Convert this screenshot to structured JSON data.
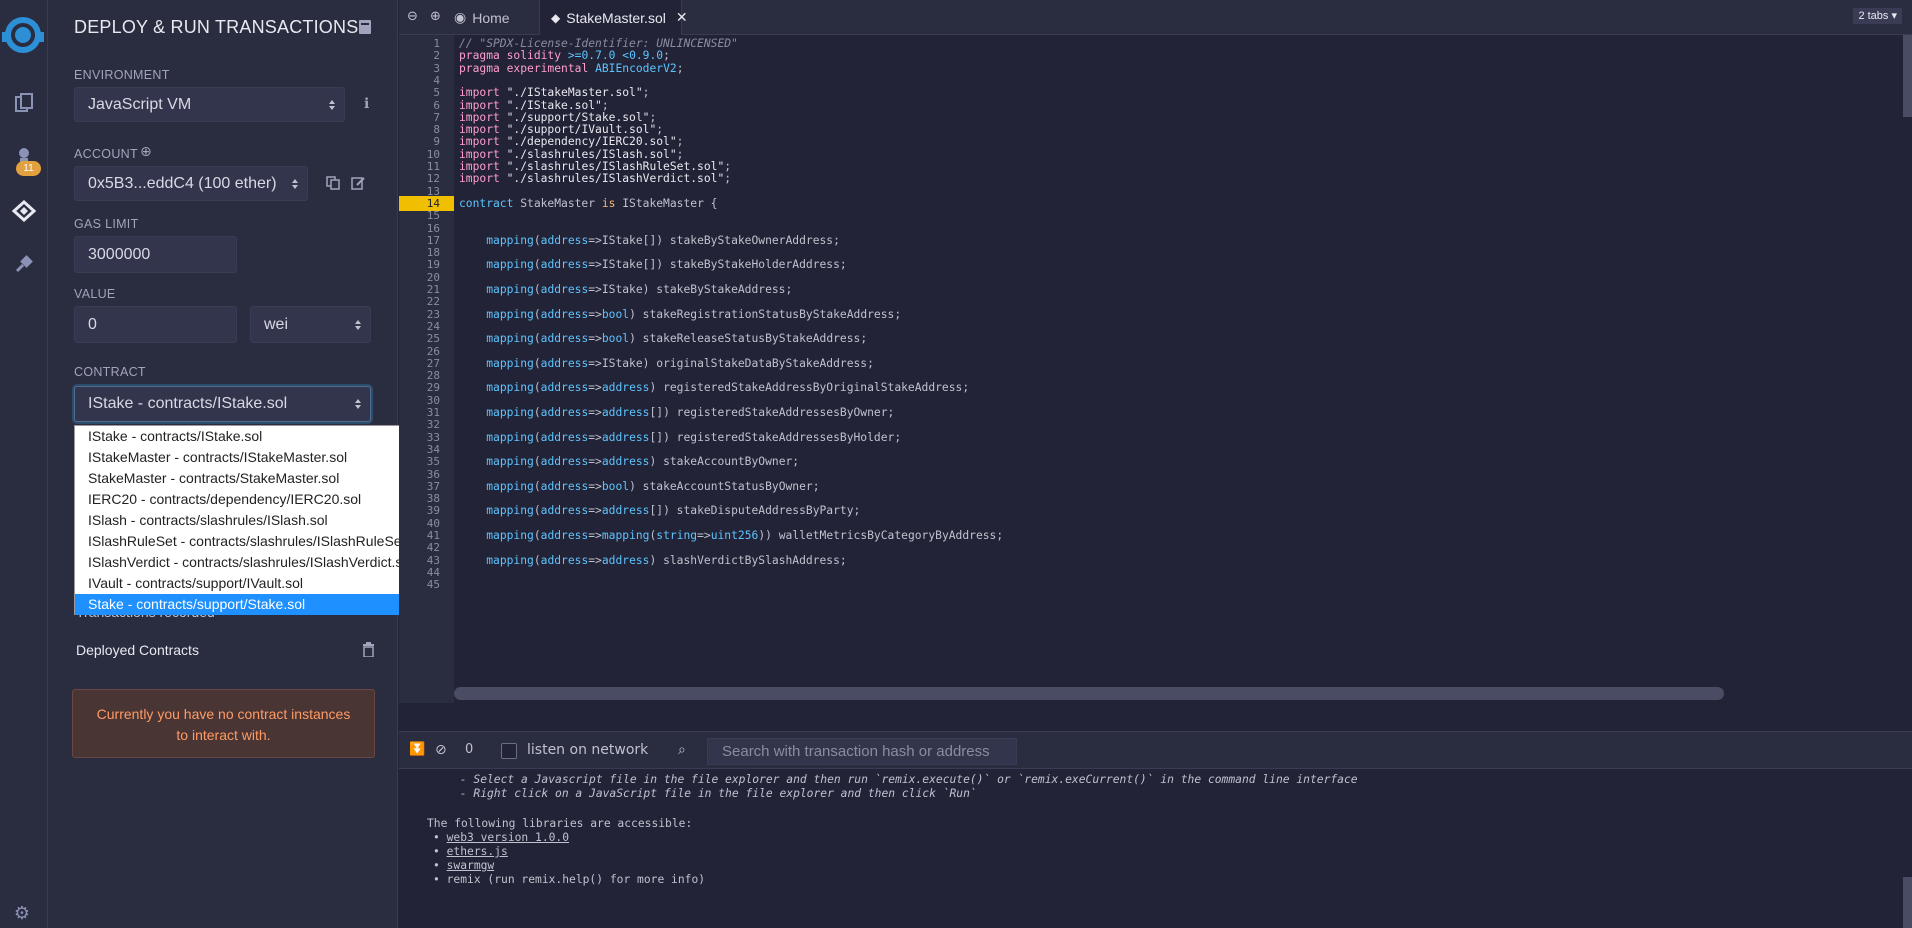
{
  "sidebar_icons": [
    "remix-logo-icon",
    "file-explorer-icon",
    "compiler-icon",
    "deploy-run-icon",
    "plugin-manager-icon",
    "settings-icon"
  ],
  "compiler_badge": "11",
  "panel": {
    "title": "DEPLOY & RUN TRANSACTIONS",
    "environment_label": "ENVIRONMENT",
    "environment_value": "JavaScript VM",
    "account_label": "ACCOUNT",
    "account_value": "0x5B3...eddC4 (100 ether)",
    "gas_label": "GAS LIMIT",
    "gas_value": "3000000",
    "value_label": "VALUE",
    "value_amount": "0",
    "value_unit": "wei",
    "contract_label": "CONTRACT",
    "contract_value": "IStake - contracts/IStake.sol",
    "contract_options": [
      "IStake - contracts/IStake.sol",
      "IStakeMaster - contracts/IStakeMaster.sol",
      "StakeMaster - contracts/StakeMaster.sol",
      "IERC20 - contracts/dependency/IERC20.sol",
      "ISlash - contracts/slashrules/ISlash.sol",
      "ISlashRuleSet - contracts/slashrules/ISlashRuleSet.sol",
      "ISlashVerdict - contracts/slashrules/ISlashVerdict.sol",
      "IVault - contracts/support/IVault.sol",
      "Stake - contracts/support/Stake.sol"
    ],
    "selected_option_index": 8,
    "transactions_recorded": "Transactions recorded",
    "deployed_label": "Deployed Contracts",
    "no_instances_line1": "Currently you have no contract instances",
    "no_instances_line2": "to interact with."
  },
  "tabs": {
    "home": "Home",
    "active": "StakeMaster.sol",
    "count": "2 tabs"
  },
  "editor": {
    "highlight_line": 14,
    "line_numbers": [
      "1",
      "2",
      "3",
      "4",
      "5",
      "6",
      "7",
      "8",
      "9",
      "10",
      "11",
      "12",
      "13",
      "14",
      "15",
      "16",
      "17",
      "18",
      "19",
      "20",
      "21",
      "22",
      "23",
      "24",
      "25",
      "26",
      "27",
      "28",
      "29",
      "30",
      "31",
      "32",
      "33",
      "34",
      "35",
      "36",
      "37",
      "38",
      "39",
      "40",
      "41",
      "42",
      "43",
      "44",
      "45"
    ],
    "lines": [
      "// \"SPDX-License-Identifier: UNLINCENSED\"",
      "pragma solidity >=0.7.0 <0.9.0;",
      "pragma experimental ABIEncoderV2;",
      "",
      "import \"./IStakeMaster.sol\";",
      "import \"./IStake.sol\";",
      "import \"./support/Stake.sol\";",
      "import \"./support/IVault.sol\";",
      "import \"./dependency/IERC20.sol\";",
      "import \"./slashrules/ISlash.sol\";",
      "import \"./slashrules/ISlashRuleSet.sol\";",
      "import \"./slashrules/ISlashVerdict.sol\";",
      "",
      "contract StakeMaster is IStakeMaster {",
      "",
      "",
      "    mapping(address=>IStake[]) stakeByStakeOwnerAddress;",
      "",
      "    mapping(address=>IStake[]) stakeByStakeHolderAddress;",
      "",
      "    mapping(address=>IStake) stakeByStakeAddress;",
      "",
      "    mapping(address=>bool) stakeRegistrationStatusByStakeAddress;",
      "",
      "    mapping(address=>bool) stakeReleaseStatusByStakeAddress;",
      "",
      "    mapping(address=>IStake) originalStakeDataByStakeAddress;",
      "",
      "    mapping(address=>address) registeredStakeAddressByOriginalStakeAddress;",
      "",
      "    mapping(address=>address[]) registeredStakeAddressesByOwner;",
      "",
      "    mapping(address=>address[]) registeredStakeAddressesByHolder;",
      "",
      "    mapping(address=>address) stakeAccountByOwner;",
      "",
      "    mapping(address=>bool) stakeAccountStatusByOwner;",
      "",
      "    mapping(address=>address[]) stakeDisputeAddressByParty;",
      "",
      "    mapping(address=>mapping(string=>uint256)) walletMetricsByCategoryByAddress;",
      "",
      "    mapping(address=>address) slashVerdictBySlashAddress;",
      "",
      ""
    ]
  },
  "terminal": {
    "count": "0",
    "listen_label": "listen on network",
    "search_placeholder": "Search with transaction hash or address",
    "line1": " - Select a Javascript file in the file explorer and then run `remix.execute()` or `remix.exeCurrent()` in the command line interface",
    "line2": " - Right click on a JavaScript file in the file explorer and then click `Run`",
    "libs_title": "The following libraries are accessible:",
    "lib1": "web3 version 1.0.0",
    "lib2": "ethers.js",
    "lib3": "swarmgw",
    "lib4": "remix (run remix.help() for more info)"
  }
}
